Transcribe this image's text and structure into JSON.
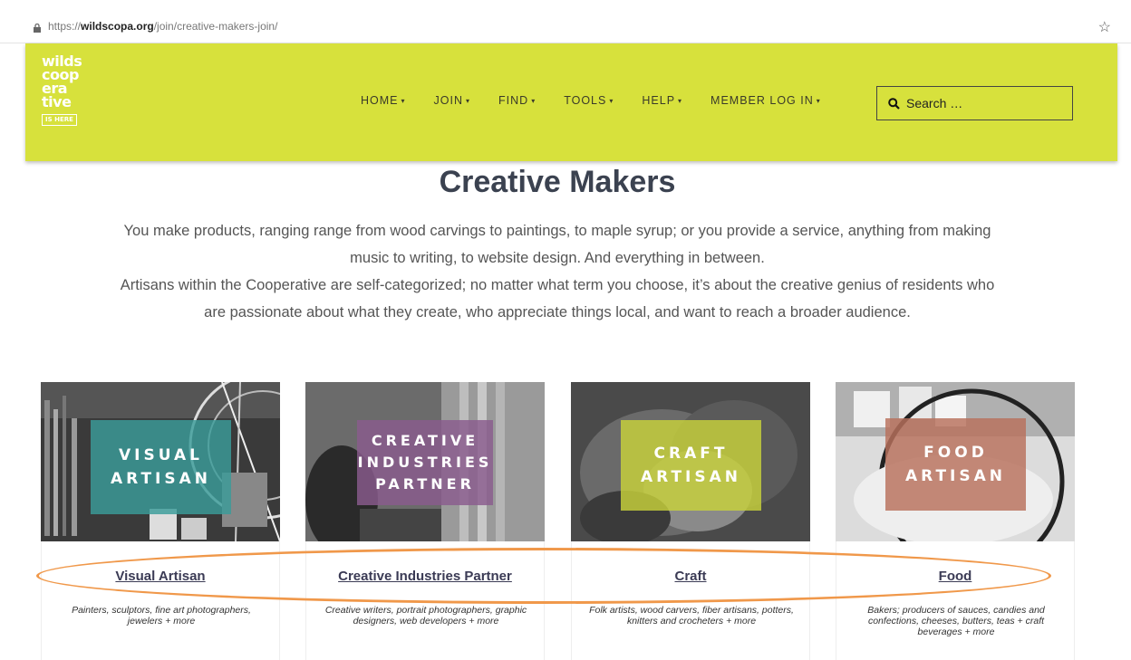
{
  "browser": {
    "url_scheme": "https://",
    "url_host": "wildscopa.org",
    "url_path": "/join/creative-makers-join/"
  },
  "header": {
    "logo_lines": [
      "wilds",
      "coop",
      "era",
      "tive"
    ],
    "logo_tag": "IS HERE",
    "nav": [
      {
        "label": "HOME"
      },
      {
        "label": "JOIN"
      },
      {
        "label": "FIND"
      },
      {
        "label": "TOOLS"
      },
      {
        "label": "HELP"
      },
      {
        "label": "MEMBER LOG IN"
      }
    ],
    "search_placeholder": "Search …",
    "bg_color": "#d7e13c"
  },
  "main": {
    "title": "Creative Makers",
    "intro_1": "You make products, ranging range from wood carvings to paintings, to maple syrup; or you provide a service, anything from making music to writing, to website design. And everything in between.",
    "intro_2": "Artisans within the Cooperative are self-categorized; no matter what term you choose, it’s about the creative genius of residents who are passionate about what they create, who appreciate things local, and want to reach a broader audience.",
    "cards": [
      {
        "overlay_lines": [
          "VISUAL",
          "ARTISAN"
        ],
        "overlay_color": "#3a9c9a",
        "title": "Visual Artisan",
        "desc": "Painters, sculptors, fine art photographers, jewelers + more"
      },
      {
        "overlay_lines": [
          "CREATIVE",
          "INDUSTRIES",
          "PARTNER"
        ],
        "overlay_color": "#8a5c8e",
        "title": "Creative Industries Partner",
        "desc": "Creative writers, portrait photographers, graphic designers, web developers + more"
      },
      {
        "overlay_lines": [
          "CRAFT",
          "ARTISAN"
        ],
        "overlay_color": "#c8d23a",
        "title": "Craft",
        "desc": "Folk artists, wood carvers, fiber artisans, potters, knitters and crocheters + more"
      },
      {
        "overlay_lines": [
          "FOOD",
          "ARTISAN"
        ],
        "overlay_color": "#b8705c",
        "title": "Food",
        "desc": "Bakers; producers of sauces, candies and confections, cheeses, butters, teas + craft beverages + more"
      }
    ]
  },
  "annotation": {
    "oval_color": "#f0984a"
  }
}
